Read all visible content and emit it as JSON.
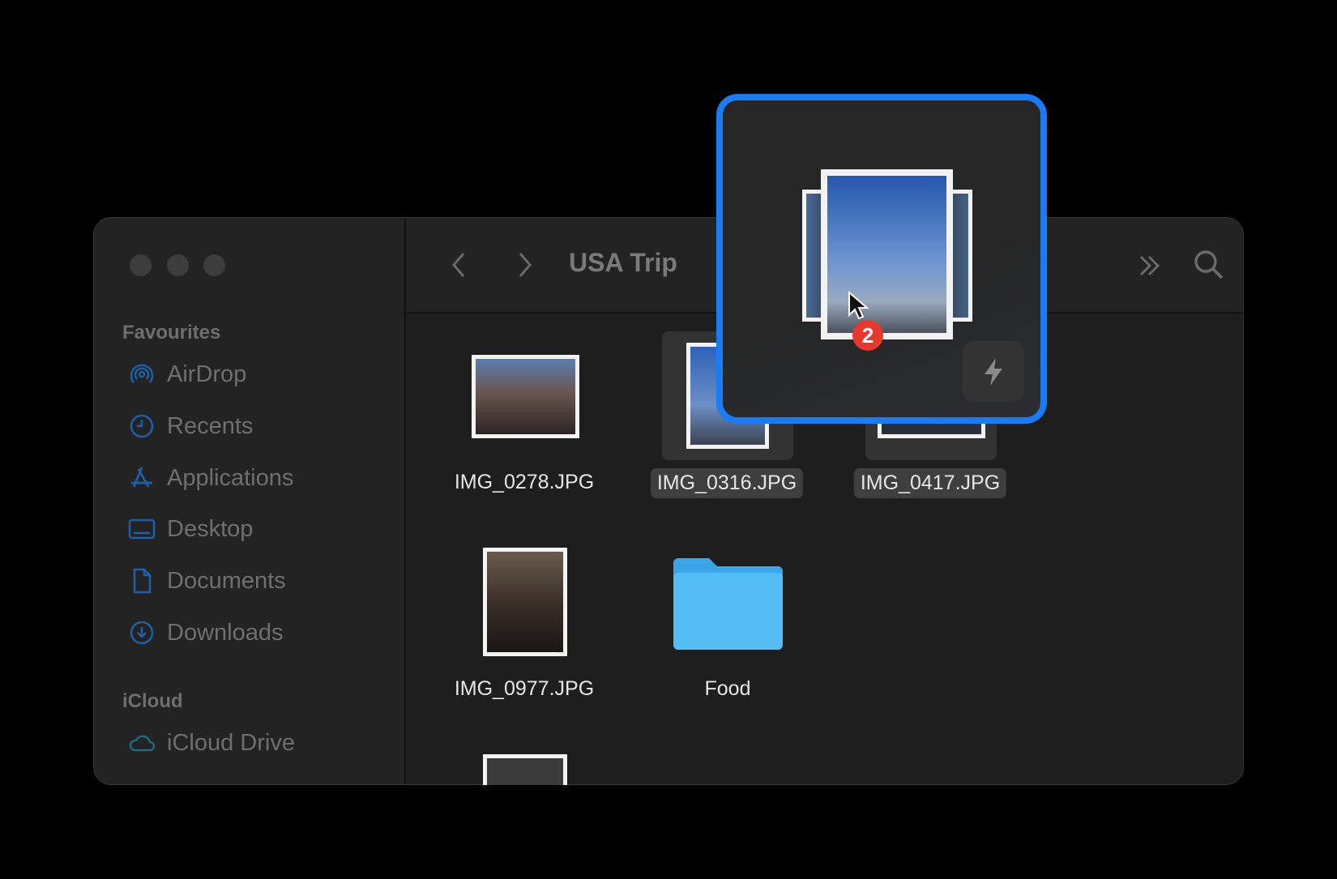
{
  "window": {
    "title": "USA Trip"
  },
  "sidebar": {
    "sections": [
      {
        "label": "Favourites",
        "items": [
          {
            "label": "AirDrop",
            "icon": "airdrop-icon"
          },
          {
            "label": "Recents",
            "icon": "clock-icon"
          },
          {
            "label": "Applications",
            "icon": "applications-icon"
          },
          {
            "label": "Desktop",
            "icon": "desktop-icon"
          },
          {
            "label": "Documents",
            "icon": "document-icon"
          },
          {
            "label": "Downloads",
            "icon": "download-icon"
          }
        ]
      },
      {
        "label": "iCloud",
        "items": [
          {
            "label": "iCloud Drive",
            "icon": "cloud-icon"
          }
        ]
      }
    ]
  },
  "toolbar": {
    "back": "chevron-left-icon",
    "forward": "chevron-right-icon",
    "more": "double-chevron-icon",
    "search": "search-icon"
  },
  "files": [
    {
      "name": "IMG_0278.JPG",
      "selected": false
    },
    {
      "name": "IMG_0316.JPG",
      "selected": true
    },
    {
      "name": "IMG_0417.JPG",
      "selected": true
    },
    {
      "name": "IMG_0977.JPG",
      "selected": false
    },
    {
      "name": "Food",
      "type": "folder",
      "selected": false
    }
  ],
  "drag_preview": {
    "count": "2",
    "quick_action": "lightning-icon"
  },
  "colors": {
    "accent": "#1a7cf5",
    "sidebar_icon": "#1f5fa8",
    "folder": "#4fb8f5",
    "badge": "#e8372c"
  }
}
